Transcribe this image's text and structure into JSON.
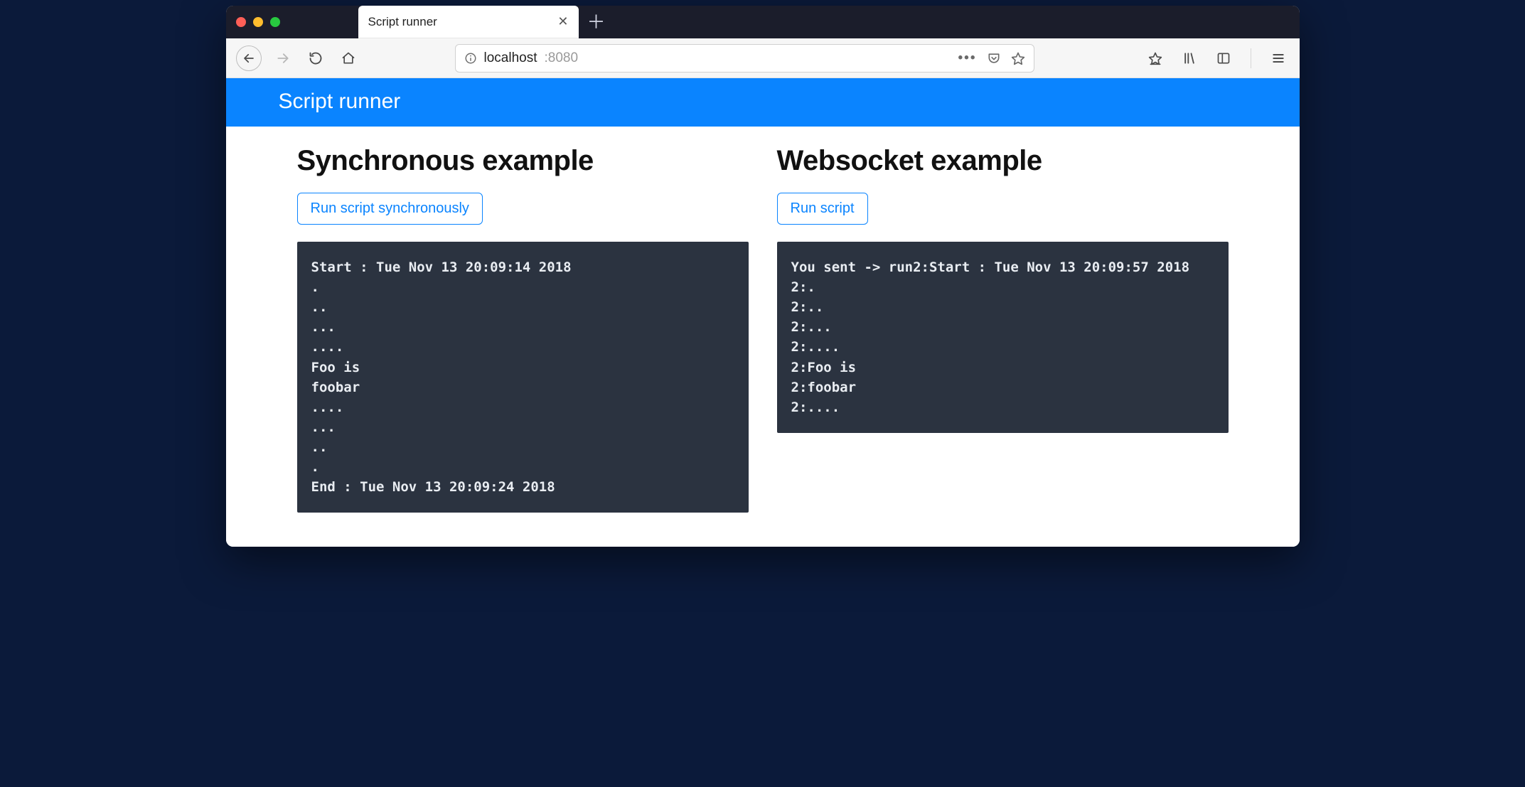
{
  "browser": {
    "tab_title": "Script runner",
    "url_host": "localhost",
    "url_port": ":8080"
  },
  "page": {
    "header": "Script runner",
    "left": {
      "heading": "Synchronous example",
      "button": "Run script synchronously",
      "output": "Start : Tue Nov 13 20:09:14 2018\n.\n..\n...\n....\nFoo is\nfoobar\n....\n...\n..\n.\nEnd : Tue Nov 13 20:09:24 2018"
    },
    "right": {
      "heading": "Websocket example",
      "button": "Run script",
      "output": "You sent -> run2:Start : Tue Nov 13 20:09:57 2018\n2:.\n2:..\n2:...\n2:....\n2:Foo is\n2:foobar\n2:...."
    }
  }
}
